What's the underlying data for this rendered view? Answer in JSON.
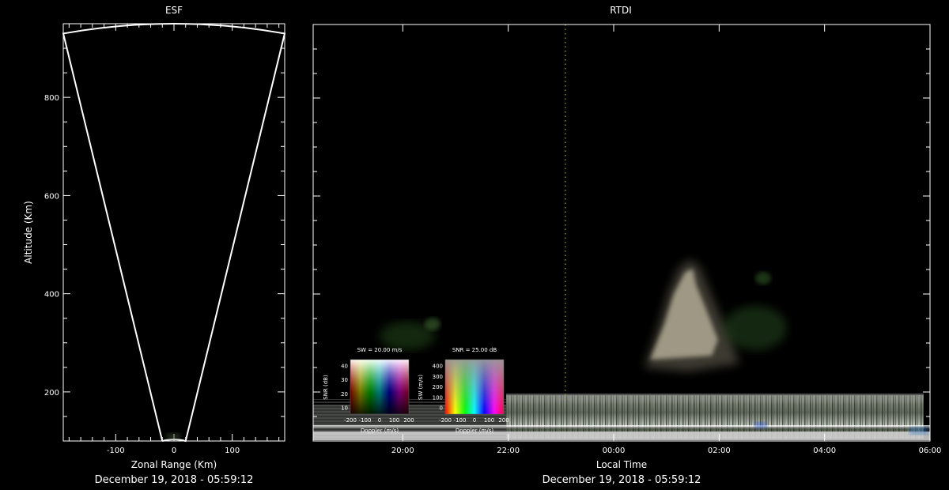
{
  "chart_data": [
    {
      "type": "scatter",
      "title": "ESF",
      "xlabel": "Zonal Range (Km)",
      "ylabel": "Altitude (Km)",
      "xlim": [
        -190,
        190
      ],
      "ylim": [
        100,
        950
      ],
      "xticks": [
        -100,
        0,
        100
      ],
      "yticks": [
        200,
        400,
        600,
        800
      ],
      "fan_outline": {
        "left_edge_bottom": [
          -20,
          100
        ],
        "left_edge_top": [
          -190,
          930
        ],
        "right_edge_bottom": [
          20,
          100
        ],
        "right_edge_top": [
          190,
          930
        ],
        "arc_apex_altitude": 950
      },
      "footer": "December 19, 2018 - 05:59:12"
    },
    {
      "type": "heatmap",
      "title": "RTDI",
      "xlabel": "Local Time",
      "xticks": [
        "20:00",
        "22:00",
        "00:00",
        "02:00",
        "04:00",
        "06:00"
      ],
      "x_range_hours": [
        18.3,
        30.0
      ],
      "marker_line_time": "23:05",
      "footer": "December 19, 2018 - 05:59:12"
    }
  ],
  "legends": {
    "sw_legend": {
      "title": "SW = 20.00 m/s",
      "xlabel": "Doppler (m/s)",
      "ylabel": "SNR (dB)",
      "xticks": [
        "-200",
        "-100",
        "0",
        "100",
        "200"
      ],
      "yticks": [
        "10",
        "20",
        "30",
        "40"
      ]
    },
    "snr_legend": {
      "title": "SNR = 25.00 dB",
      "xlabel": "Doppler (m/s)",
      "ylabel": "SW (m/s)",
      "xticks": [
        "-200",
        "-100",
        "0",
        "100",
        "200"
      ],
      "yticks": [
        "0",
        "100",
        "200",
        "300",
        "400"
      ]
    }
  },
  "colors": {
    "background": "#000000",
    "axes": "#ffffff",
    "marker_line": "#8a8a2a"
  }
}
